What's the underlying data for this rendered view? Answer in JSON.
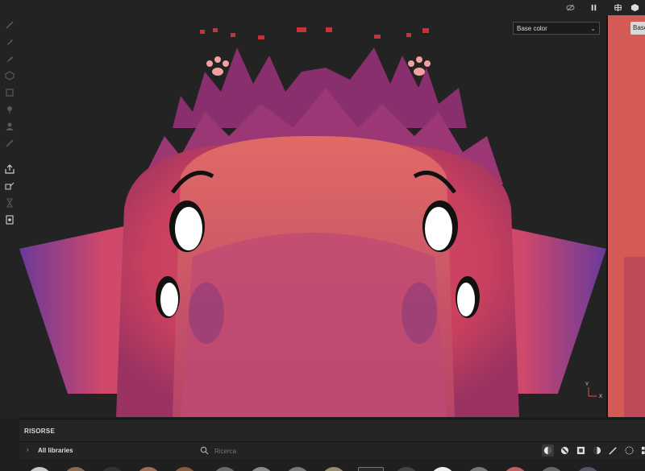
{
  "viewport": {
    "channel_label": "Base color",
    "secondary_channel_label": "Base"
  },
  "gizmo": {
    "y": "Y",
    "x": "X"
  },
  "panel": {
    "title": "RISORSE",
    "library_label": "All libraries",
    "search_placeholder": "Ricerca"
  },
  "toolbar_left": [
    "brush-icon",
    "eraser-icon",
    "projection-icon",
    "geometry-mask-icon",
    "fill-icon",
    "smudge-icon",
    "clone-icon",
    "color-picker-icon",
    "bake-icon",
    "export-icon",
    "layer-icon",
    "history-icon",
    "document-icon"
  ],
  "toolbar_top": [
    "visibility-off-icon",
    "pause-icon",
    "split-view-icon",
    "cube-icon"
  ],
  "filters": [
    "all-assets-icon",
    "materials-icon",
    "smart-materials-icon",
    "masks-icon",
    "brushes-icon",
    "particles-icon",
    "more-icon"
  ],
  "colors": {
    "panel_bg": "#232323",
    "accent": "#e0e0e0",
    "model_pink": "#e0506a",
    "model_purple": "#8a2f6e"
  }
}
